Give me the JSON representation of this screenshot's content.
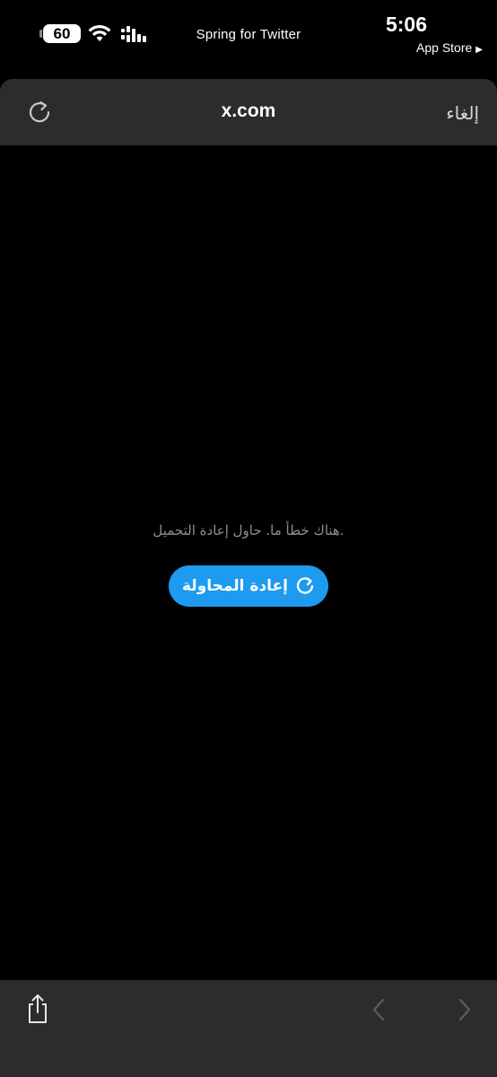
{
  "status_bar": {
    "battery": "60",
    "title": "Spring for Twitter",
    "time": "5:06",
    "back_app": "App Store"
  },
  "header": {
    "url": "x.com",
    "cancel_label": "إلغاء",
    "reload_icon": "reload-icon"
  },
  "content": {
    "error_message": ".هناك خطأ ما. حاول إعادة التحميل",
    "retry_label": "إعادة المحاولة"
  },
  "colors": {
    "accent": "#1d9bf0",
    "bar_bg": "#2c2c2e",
    "page_bg": "#000000",
    "muted_text": "#8b8f94"
  },
  "toolbar": {
    "share_icon": "share-icon",
    "back_icon": "chevron-left-icon",
    "forward_icon": "chevron-right-icon"
  }
}
